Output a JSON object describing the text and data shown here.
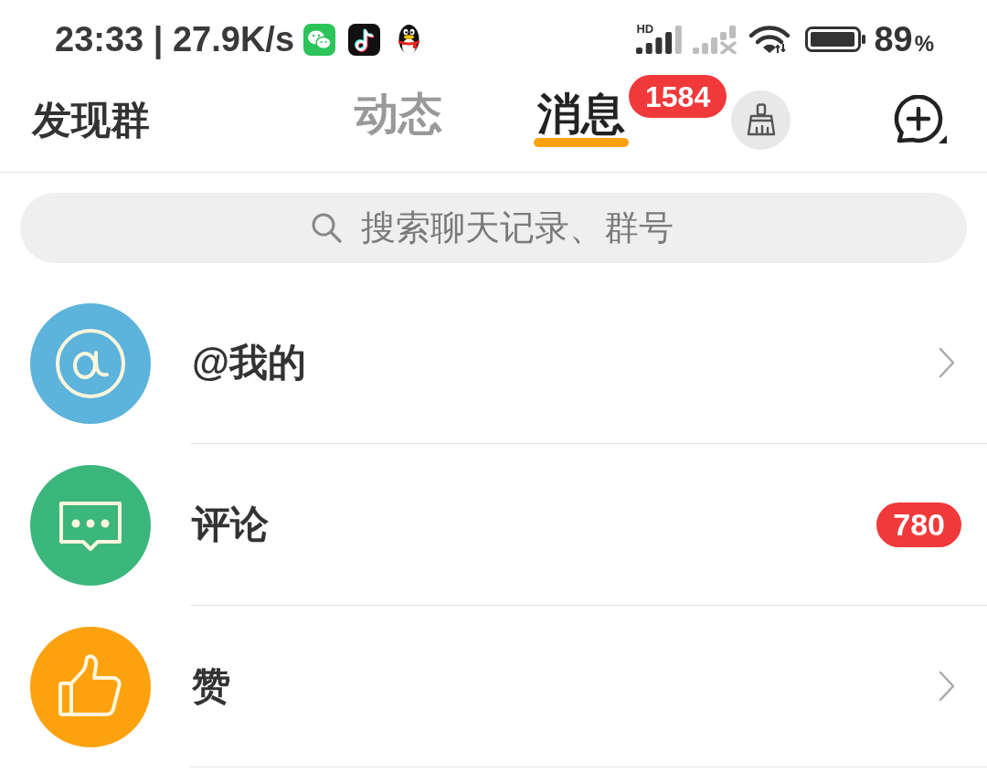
{
  "status_bar": {
    "time_speed": "23:33 | 27.9K/s",
    "signal_label": "HD",
    "battery": "89",
    "battery_unit": "%"
  },
  "header": {
    "left_link": "发现群",
    "tabs": [
      {
        "label": "动态",
        "selected": false
      },
      {
        "label": "消息",
        "selected": true,
        "badge": "1584"
      }
    ]
  },
  "search": {
    "placeholder": "搜索聊天记录、群号"
  },
  "items": [
    {
      "kind": "mention",
      "label": "@我的",
      "color": "#5cb3dc"
    },
    {
      "kind": "comment",
      "label": "评论",
      "color": "#3bb67c",
      "badge": "780"
    },
    {
      "kind": "like",
      "label": "赞",
      "color": "#fca20f"
    }
  ]
}
